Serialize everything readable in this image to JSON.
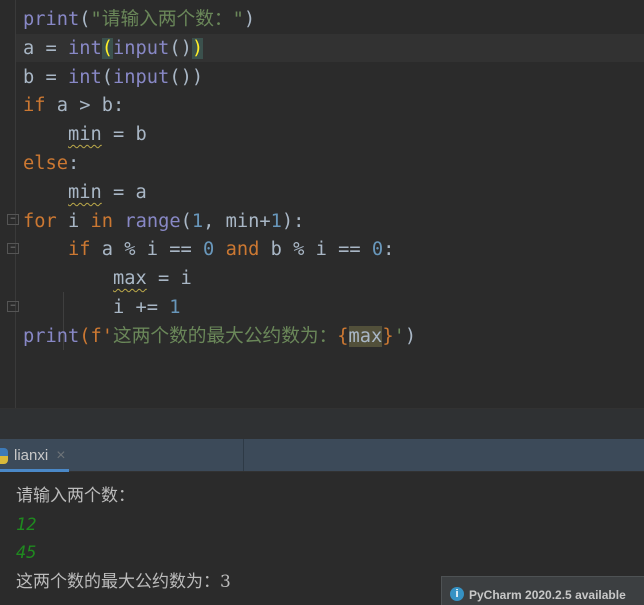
{
  "editor": {
    "lines": [
      [
        "print",
        "(",
        "\"请输入两个数：\"",
        ")"
      ],
      [
        "a = ",
        "int",
        "(",
        "input",
        "()",
        ")"
      ],
      [
        "b = ",
        "int",
        "(",
        "input",
        "())"
      ],
      [
        "if",
        " a > b:"
      ],
      [
        "    ",
        "min",
        " = b"
      ],
      [
        "else",
        ":"
      ],
      [
        "    ",
        "min",
        " = a"
      ],
      [
        "for",
        " i ",
        "in",
        " ",
        "range",
        "(",
        "1",
        ", min+",
        "1",
        "):"
      ],
      [
        "    ",
        "if",
        " a % i == ",
        "0",
        " ",
        "and",
        " b % i == ",
        "0",
        ":"
      ],
      [
        "        ",
        "max",
        " = i"
      ],
      [
        "        i += ",
        "1"
      ],
      [
        "print",
        "(f'",
        "这两个数的最大公约数为：",
        "{",
        "max",
        "}",
        "'",
        ")"
      ]
    ]
  },
  "run_tab": {
    "label": "lianxi",
    "close": "×",
    "icon": "python-icon"
  },
  "console": {
    "prompt": "请输入两个数：",
    "input1": "12",
    "input2": "45",
    "result": "这两个数的最大公约数为：3"
  },
  "notification": {
    "icon": "info-icon",
    "text": "PyCharm 2020.2.5 available"
  }
}
